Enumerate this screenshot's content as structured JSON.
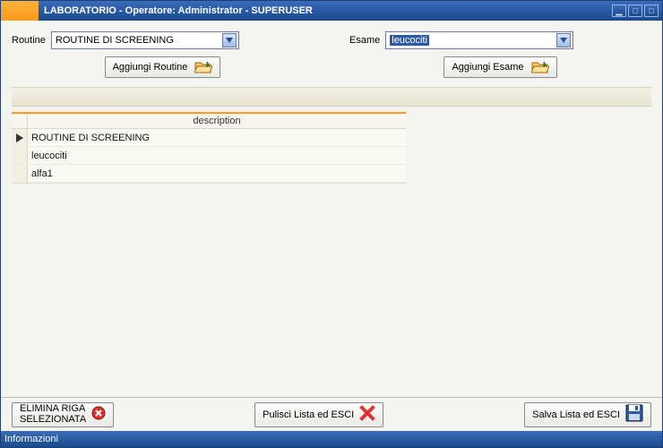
{
  "title": "LABORATORIO - Operatore: Administrator -  SUPERUSER",
  "routine": {
    "label": "Routine",
    "value": "ROUTINE DI SCREENING",
    "add_button": "Aggiungi Routine"
  },
  "exam": {
    "label": "Esame",
    "value": "leucociti",
    "add_button": "Aggiungi Esame"
  },
  "grid": {
    "header": "description",
    "rows": [
      {
        "text": "ROUTINE DI SCREENING",
        "selected": true
      },
      {
        "text": "leucociti",
        "selected": false
      },
      {
        "text": "alfa1",
        "selected": false
      }
    ]
  },
  "footer": {
    "delete_line1": "ELIMINA RIGA",
    "delete_line2": "SELEZIONATA",
    "clear": "Pulisci Lista ed ESCI",
    "save": "Salva Lista ed ESCI"
  },
  "status": "Informazioni"
}
